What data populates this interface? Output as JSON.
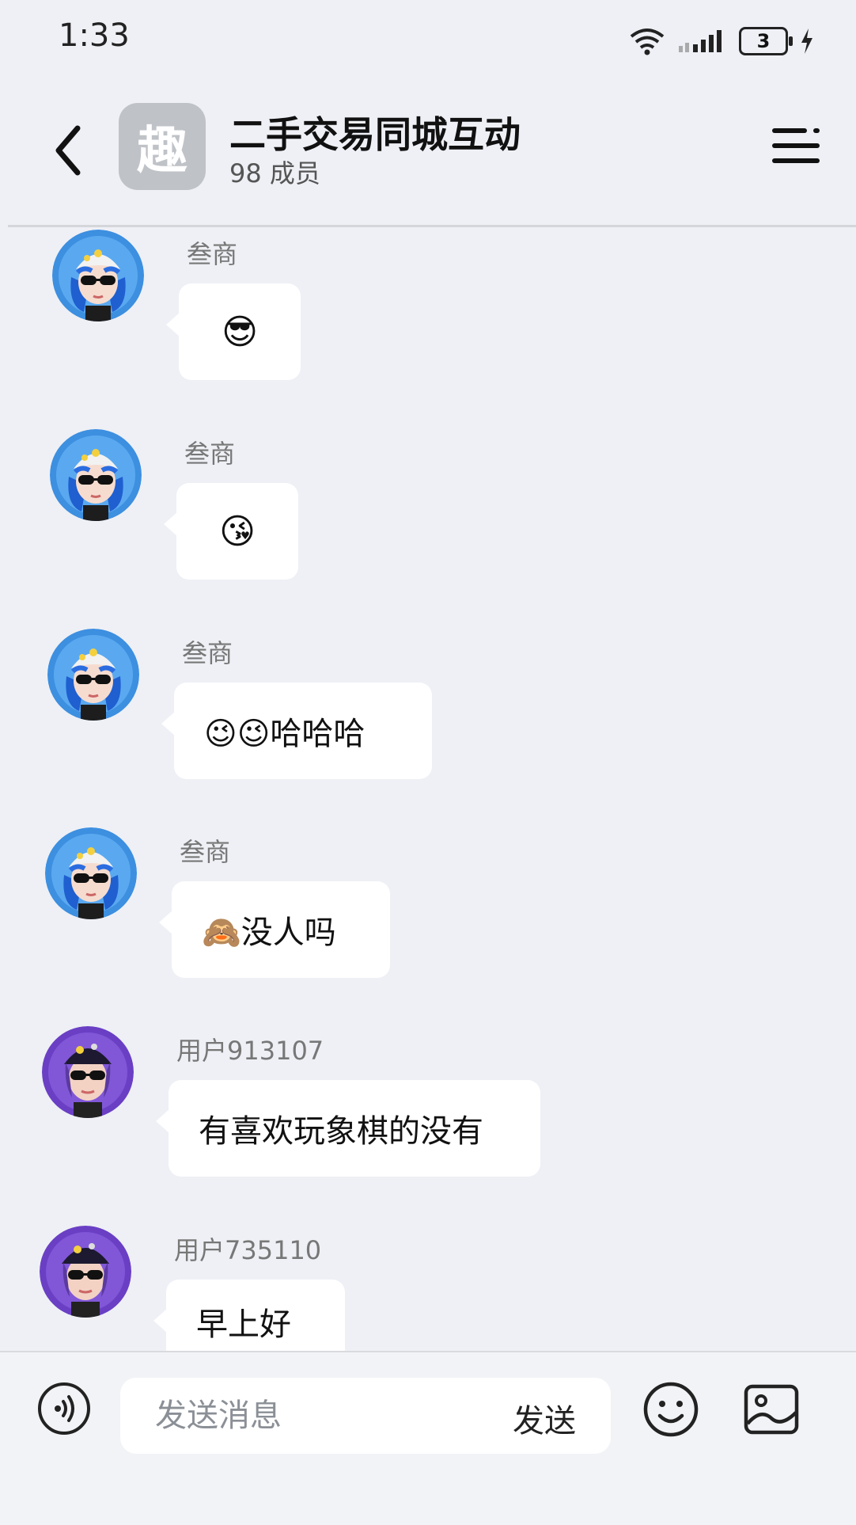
{
  "status_bar": {
    "time": "1:33",
    "battery": "3"
  },
  "header": {
    "group_avatar_char": "趣",
    "title": "二手交易同城互动",
    "subtitle": "98 成员"
  },
  "messages": [
    {
      "sender": "叁商",
      "text": "😎",
      "avatar": "blue-hair"
    },
    {
      "sender": "叁商",
      "text": "😘",
      "avatar": "blue-hair"
    },
    {
      "sender": "叁商",
      "text": "😉😉哈哈哈",
      "avatar": "blue-hair"
    },
    {
      "sender": "叁商",
      "text": "🙈没人吗",
      "avatar": "blue-hair"
    },
    {
      "sender": "用户913107",
      "text": "有喜欢玩象棋的没有",
      "avatar": "purple-hat"
    },
    {
      "sender": "用户735110",
      "text": "早上好",
      "avatar": "purple-hat"
    }
  ],
  "input": {
    "placeholder": "发送消息",
    "value": "",
    "send_label": "发送"
  },
  "colors": {
    "background": "#eef0f5",
    "bubble": "#ffffff",
    "blue_avatar": "#3d8fe0",
    "purple_avatar": "#6a3fc4"
  }
}
